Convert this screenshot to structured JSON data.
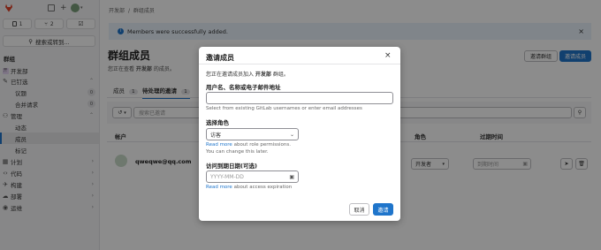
{
  "sidebar": {
    "issues_count": "1",
    "mr_count": "2",
    "search_label": "搜索或转到...",
    "section_title": "群组",
    "items": [
      {
        "icon": "group-avatar",
        "label": "开发部",
        "indent": false
      },
      {
        "icon": "pin-icon",
        "label": "已钉选",
        "indent": false,
        "chevron": "⌃"
      },
      {
        "label": "议题",
        "count": "0",
        "indent": true
      },
      {
        "label": "合并请求",
        "count": "0",
        "indent": true
      },
      {
        "icon": "users-icon",
        "label": "管理",
        "indent": false,
        "chevron": "⌃"
      },
      {
        "label": "动态",
        "indent": true
      },
      {
        "label": "成员",
        "indent": true,
        "active": true
      },
      {
        "label": "标记",
        "indent": true
      },
      {
        "icon": "plan-icon",
        "label": "计划",
        "indent": false,
        "chevron": "›"
      },
      {
        "icon": "code-icon",
        "label": "代码",
        "indent": false,
        "chevron": "›"
      },
      {
        "icon": "build-icon",
        "label": "构建",
        "indent": false,
        "chevron": "›"
      },
      {
        "icon": "deploy-icon",
        "label": "部署",
        "indent": false,
        "chevron": "›"
      },
      {
        "icon": "operate-icon",
        "label": "运维",
        "indent": false,
        "chevron": "›"
      }
    ]
  },
  "breadcrumb": {
    "parent": "开发部",
    "current": "群组成员"
  },
  "banner": {
    "text": "Members were successfully added."
  },
  "page": {
    "title": "群组成员",
    "subtitle_prefix": "您正在查看 ",
    "subtitle_group": "开发部",
    "subtitle_suffix": " 的成员。",
    "btn_invite_group": "邀请群组",
    "btn_invite_member": "邀请成员",
    "tabs": [
      {
        "label": "成员",
        "count": "1"
      },
      {
        "label": "待处理的邀请",
        "count": "1"
      }
    ],
    "filter_placeholder": "搜索已邀请",
    "table_headers": {
      "account": "帐户",
      "role": "角色",
      "expiry": "过期时间"
    },
    "row": {
      "email": "qweqwe@qq.com",
      "role": "开发者",
      "expiry_placeholder": "到期时间"
    }
  },
  "modal": {
    "title": "邀请成员",
    "intro_prefix": "您正在邀请成员加入 ",
    "intro_group": "开发部",
    "intro_suffix": " 群组。",
    "username_label": "用户名、名称或电子邮件地址",
    "username_value": "",
    "username_help": "Select from existing GitLab usernames or enter email addresses",
    "role_label": "选择角色",
    "role_value": "访客",
    "role_help_link": "Read more",
    "role_help_text": " about role permissions.",
    "role_help_text2": "You can change this later.",
    "expiry_label": "访问到期日期(可选)",
    "expiry_placeholder": "YYYY-MM-DD",
    "expiry_help_link": "Read more",
    "expiry_help_text": " about access expiration",
    "cancel_label": "取消",
    "invite_label": "邀请"
  },
  "colors": {
    "accent": "#1f75cb",
    "banner_bg": "#e9f3fc",
    "overlay": "rgba(0,0,0,0.45)"
  }
}
